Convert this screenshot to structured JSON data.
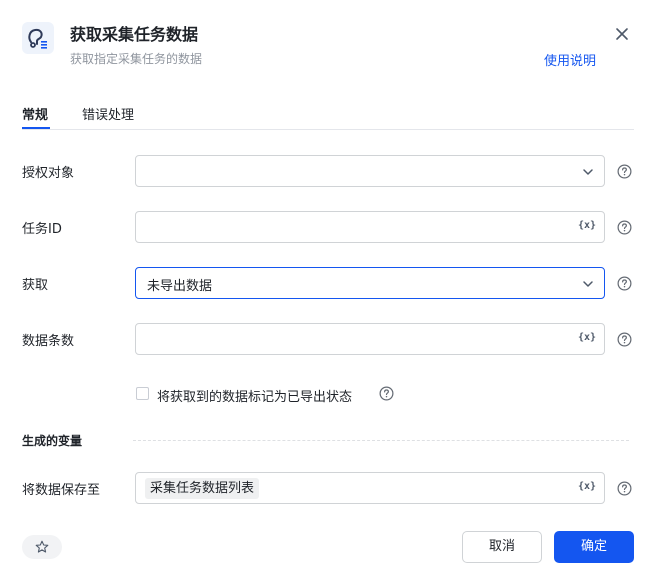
{
  "header": {
    "title": "获取采集任务数据",
    "subtitle": "获取指定采集任务的数据",
    "help_link": "使用说明",
    "icon": "collection-data-icon",
    "close_icon": "close-icon"
  },
  "tabs": [
    {
      "label": "常规",
      "active": true
    },
    {
      "label": "错误处理",
      "active": false
    }
  ],
  "form": {
    "auth_target": {
      "label": "授权对象",
      "value": "",
      "type": "select"
    },
    "task_id": {
      "label": "任务ID",
      "value": "",
      "type": "variable-input"
    },
    "fetch": {
      "label": "获取",
      "value": "未导出数据",
      "type": "select",
      "focused": true
    },
    "count": {
      "label": "数据条数",
      "value": "",
      "type": "variable-input"
    },
    "mark_exported": {
      "label": "将获取到的数据标记为已导出状态",
      "checked": false
    }
  },
  "output": {
    "section_title": "生成的变量",
    "save_to": {
      "label": "将数据保存至",
      "tag": "采集任务数据列表"
    }
  },
  "variable_icon_text": "{x}",
  "footer": {
    "cancel_label": "取消",
    "ok_label": "确定",
    "favorite_icon": "star-icon"
  },
  "colors": {
    "accent": "#1456f0",
    "text": "#1f2329",
    "muted": "#8f959e",
    "border": "#d0d3d6"
  }
}
